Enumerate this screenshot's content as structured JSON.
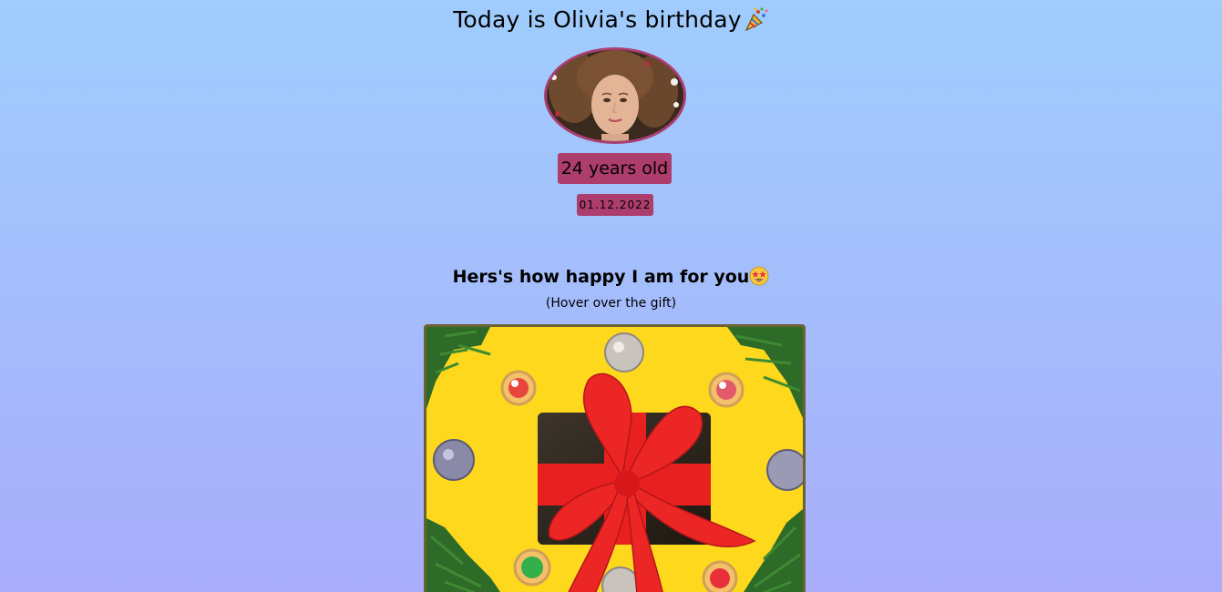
{
  "header": {
    "title": "Today is Olivia's birthday",
    "title_emoji": "party-popper-icon"
  },
  "profile": {
    "avatar": "woman-portrait-avatar",
    "age_label": "24 years old",
    "date_label": "01.12.2022"
  },
  "message": {
    "text": "Hers's how happy I am for you",
    "emoji": "star-struck-face-icon",
    "hint": "(Hover over the gift)"
  },
  "gift": {
    "image": "gift-box-with-red-ribbon",
    "background_color": "#fdd81d",
    "ribbon_color": "#e8201f",
    "box_color": "#2a241c"
  },
  "colors": {
    "badge": "#ad3d6c",
    "avatar_border": "#a93f73",
    "frame_border": "#6b6231",
    "bg_top": "#a0cdfd",
    "bg_bottom": "#a9adfb"
  }
}
